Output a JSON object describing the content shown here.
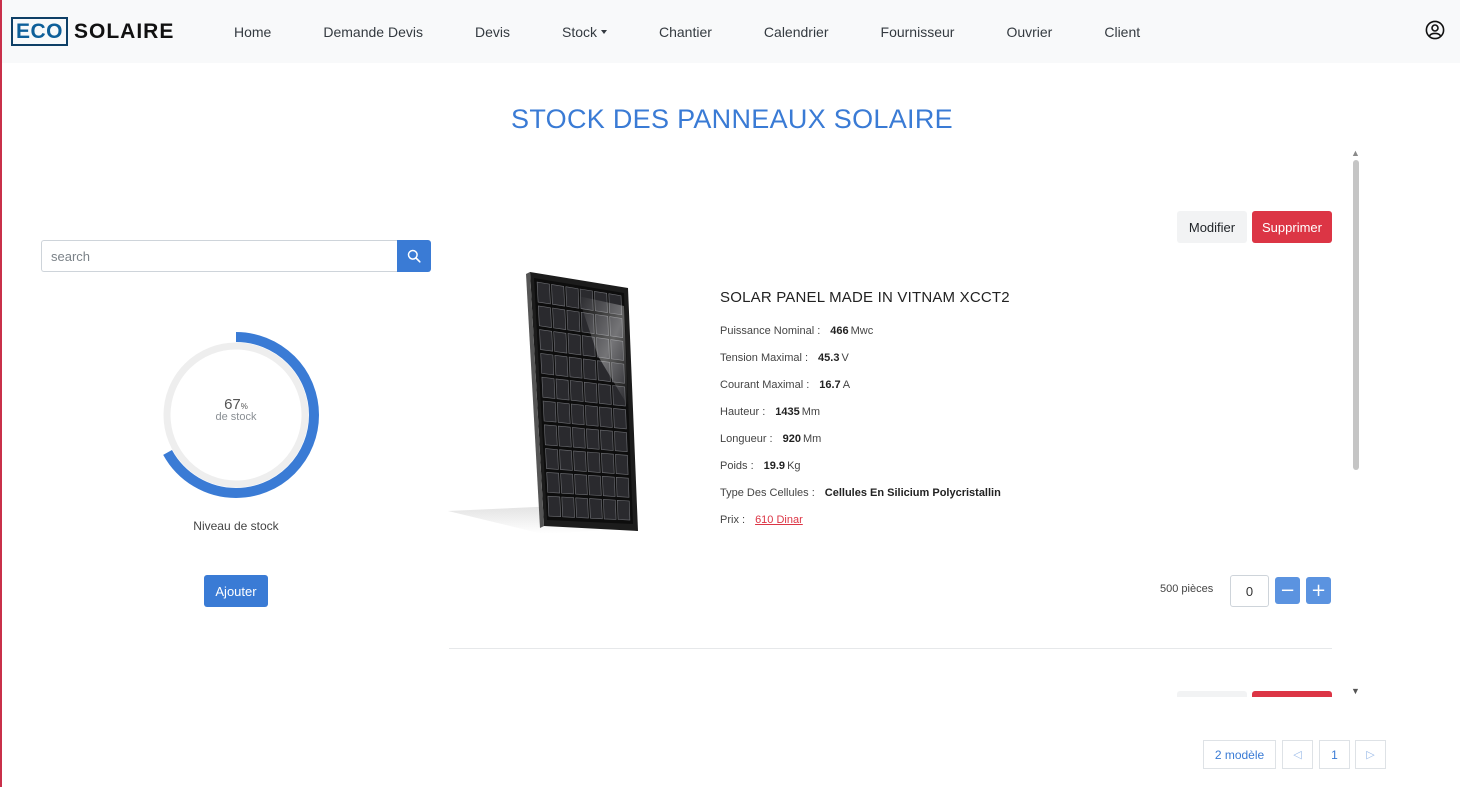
{
  "brand": {
    "eco": "ECO",
    "solaire": "SOLAIRE"
  },
  "nav": {
    "items": [
      {
        "label": "Home"
      },
      {
        "label": "Demande Devis"
      },
      {
        "label": "Devis"
      },
      {
        "label": "Stock",
        "dropdown": true
      },
      {
        "label": "Chantier"
      },
      {
        "label": "Calendrier"
      },
      {
        "label": "Fournisseur"
      },
      {
        "label": "Ouvrier"
      },
      {
        "label": "Client"
      }
    ],
    "user_icon": "user-circle-icon"
  },
  "page": {
    "title": "STOCK DES PANNEAUX SOLAIRE"
  },
  "sidebar": {
    "search_placeholder": "search",
    "search_icon": "search-icon",
    "stock_gauge": {
      "percent": 67,
      "value_text": "67",
      "unit": "%",
      "sub": "de stock",
      "label": "Niveau de stock"
    },
    "add_button": "Ajouter"
  },
  "colors": {
    "accent": "#3a7bd5",
    "danger": "#dc3545",
    "gauge_track": "#eeeeee",
    "brand_border": "#0e3f66"
  },
  "product": {
    "edit_button": "Modifier",
    "delete_button": "Supprimer",
    "name": "SOLAR PANEL MADE IN VITNAM XCCT2",
    "specs": [
      {
        "label": "Puissance Nominal :",
        "value": "466",
        "unit": "Mwc"
      },
      {
        "label": "Tension Maximal :",
        "value": "45.3",
        "unit": "V"
      },
      {
        "label": "Courant Maximal :",
        "value": "16.7",
        "unit": "A"
      },
      {
        "label": "Hauteur :",
        "value": "1435",
        "unit": "Mm"
      },
      {
        "label": "Longueur :",
        "value": "920",
        "unit": "Mm"
      },
      {
        "label": "Poids :",
        "value": "19.9",
        "unit": "Kg"
      },
      {
        "label": "Type Des Cellules :",
        "value": "Cellules En Silicium Polycristallin",
        "unit": ""
      }
    ],
    "price_label": "Prix :",
    "price": "610 Dinar",
    "stock_text": "500 pièces",
    "quantity": "0",
    "minus": "−",
    "plus": "+"
  },
  "pagination": {
    "models": "2 modèle",
    "prev": "◁",
    "page": "1",
    "next": "▷"
  },
  "scroll": {
    "up": "▲",
    "down": "▼"
  }
}
